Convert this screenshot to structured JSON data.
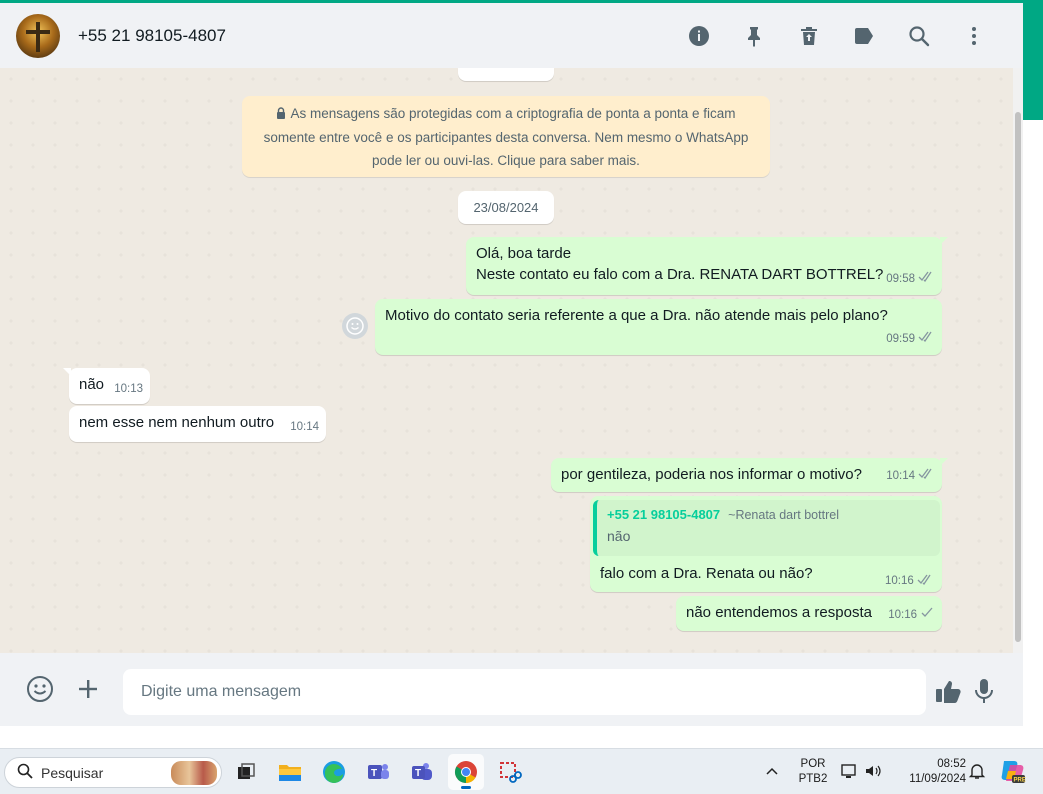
{
  "header": {
    "contact_name": "+55 21 98105-4807",
    "icons": [
      "info-icon",
      "pin-icon",
      "delete-icon",
      "label-icon",
      "search-icon",
      "menu-icon"
    ]
  },
  "encryption_notice": {
    "line1": "As mensagens são protegidas com a criptografia de ponta a ponta e ficam",
    "line2": "somente entre você e os participantes desta conversa. Nem mesmo o WhatsApp",
    "line3": "pode ler ou ouvi-las. Clique para saber mais."
  },
  "date_divider": "23/08/2024",
  "messages": [
    {
      "direction": "out",
      "lines": [
        "Olá, boa tarde",
        "Neste contato eu falo com a Dra. RENATA DART BOTTREL?"
      ],
      "time": "09:58",
      "status": "read"
    },
    {
      "direction": "out",
      "lines": [
        "Motivo do contato seria referente a que a Dra. não atende mais pelo plano?"
      ],
      "time": "09:59",
      "status": "read"
    },
    {
      "direction": "in",
      "text": "não",
      "time": "10:13"
    },
    {
      "direction": "in",
      "text": "nem esse nem nenhum outro",
      "time": "10:14"
    },
    {
      "direction": "out",
      "text": "por gentileza, poderia nos informar o motivo?",
      "time": "10:14",
      "status": "read"
    },
    {
      "direction": "out",
      "quote": {
        "phone": "+55 21 98105-4807",
        "alias": "~Renata dart bottrel",
        "text": "não"
      },
      "text": "falo com a Dra. Renata ou não?",
      "time": "10:16",
      "status": "read"
    },
    {
      "direction": "out",
      "text": "não entendemos a resposta",
      "time": "10:16",
      "status": "sent"
    }
  ],
  "composer": {
    "placeholder": "Digite uma mensagem"
  },
  "taskbar": {
    "search_label": "Pesquisar",
    "lang_line1": "POR",
    "lang_line2": "PTB2",
    "time": "08:52",
    "date": "11/09/2024",
    "apps": [
      "task-view",
      "file-explorer",
      "edge",
      "teams",
      "teams-classic",
      "chrome",
      "snipping-tool"
    ]
  },
  "colors": {
    "accent": "#00a884",
    "outgoing_bubble": "#d9fdd3",
    "incoming_bubble": "#ffffff",
    "notice_bg": "#ffeecd",
    "quote_accent": "#06cf9c"
  }
}
